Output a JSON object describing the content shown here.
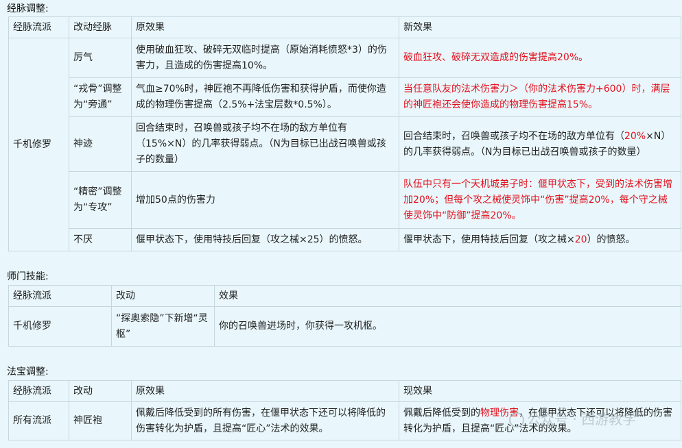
{
  "sections": {
    "meridian": {
      "title": "经脉调整:",
      "headers": [
        "经脉流派",
        "改动经脉",
        "原效果",
        "新效果"
      ],
      "school": "千机修罗",
      "rows": [
        {
          "change": "厉气",
          "original": "使用破血狂攻、破碎无双临时提高（原始消耗愤怒*3）的伤害力，且造成的伤害提高10%。",
          "new_red": "破血狂攻、破碎无双造成的伤害提高20%。"
        },
        {
          "change": "“戎骨”调整为“旁通”",
          "original": "气血≥70%时，神匠袍不再降低伤害和获得护盾，而使你造成的物理伤害提高（2.5%+法宝层数*0.5%）。",
          "new_red": "当任意队友的法术伤害力＞（你的法术伤害力+600）时，满层的神匠袍还会使你造成的物理伤害提高15%。"
        },
        {
          "change": "神迹",
          "original": "回合结束时，召唤兽或孩子均不在场的敌方单位有（15%×N）的几率获得弱点。（N为目标已出战召唤兽或孩子的数量）",
          "new_pre": "回合结束时，召唤兽或孩子均不在场的敌方单位有（",
          "new_hl": "20%",
          "new_post": "×N）的几率获得弱点。（N为目标已出战召唤兽或孩子的数量）"
        },
        {
          "change": "“精密”调整为“专攻”",
          "original": "增加50点的伤害力",
          "new_red": "队伍中只有一个天机城弟子时：偃甲状态下，受到的法术伤害增加20%；但每个攻之械使灵饰中“伤害”提高20%，每个守之械使灵饰中“防御”提高20%。"
        },
        {
          "change": "不厌",
          "original": "偃甲状态下，使用特技后回复（攻之械×25）的愤怒。",
          "new_pre": "偃甲状态下，使用特技后回复（攻之械×",
          "new_hl": "20",
          "new_post": "）的愤怒。"
        }
      ]
    },
    "skills": {
      "title": "师门技能:",
      "headers": [
        "经脉流派",
        "改动",
        "效果"
      ],
      "school": "千机修罗",
      "change": "“探奥索隐”下新增“灵枢”",
      "effect": "你的召唤兽进场时，你获得一攻机枢。"
    },
    "treasure": {
      "title": "法宝调整:",
      "headers": [
        "经脉流派",
        "改动",
        "原效果",
        "现效果"
      ],
      "school": "所有流派",
      "change": "神匠袍",
      "original": "佩戴后降低受到的所有伤害，在偃甲状态下还可以将降低的伤害转化为护盾，且提高“匠心”法术的效果。",
      "new_pre": "佩戴后降低受到的",
      "new_hl": "物理伤害",
      "new_post": "，在偃甲状态下还可以将降低的伤害转化为护盾，且提高“匠心”法术的效果。"
    }
  },
  "watermark": {
    "text": "公众号 · 西游教学"
  },
  "colors": {
    "highlight": "#e3101c",
    "background": "#e9f7fc",
    "border": "#c5d6dd"
  }
}
